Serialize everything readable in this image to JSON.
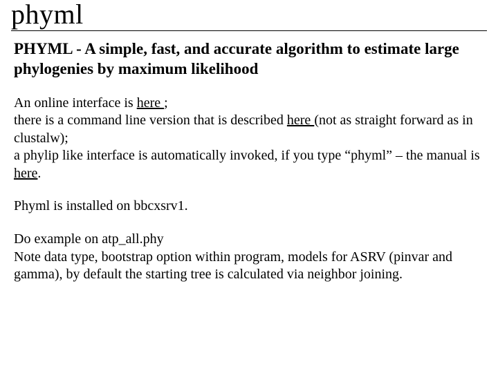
{
  "title": "phyml",
  "subtitle": "PHYML - A simple, fast, and accurate algorithm to estimate large phylogenies by maximum likelihood",
  "p1_a": "An online interface is ",
  "p1_link1": "here ",
  "p1_b": ";",
  "p1_c": "there is a command line version that is described ",
  "p1_link2": "here ",
  "p1_d": "(not as  straight forward as in clustalw);",
  "p1_e": "a phylip like interface is automatically invoked, if you type “phyml” – the manual is ",
  "p1_link3": "here",
  "p1_f": ".",
  "p2": "Phyml is installed on bbcxsrv1.",
  "p3": "Do example on atp_all.phy\nNote data type, bootstrap option within program, models for ASRV (pinvar and gamma), by default the starting tree is calculated via neighbor joining."
}
